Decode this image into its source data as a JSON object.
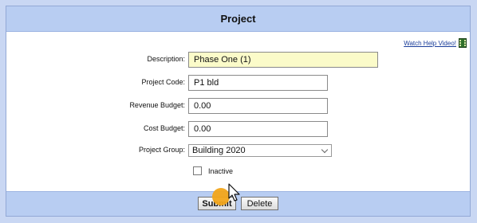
{
  "header": {
    "title": "Project"
  },
  "help": {
    "link_label": "Watch Help Video!",
    "icon": "film-icon"
  },
  "form": {
    "description": {
      "label": "Description:",
      "value": "Phase One (1)"
    },
    "project_code": {
      "label": "Project Code:",
      "value": "P1 bld"
    },
    "revenue_budget": {
      "label": "Revenue Budget:",
      "value": "0.00"
    },
    "cost_budget": {
      "label": "Cost Budget:",
      "value": "0.00"
    },
    "project_group": {
      "label": "Project Group:",
      "selected": "Building 2020"
    },
    "inactive": {
      "label": "Inactive",
      "checked": false
    }
  },
  "footer": {
    "submit_label": "Submit",
    "delete_label": "Delete"
  },
  "colors": {
    "header_bg": "#b8cdf2",
    "highlight_input": "#fbfbc9",
    "cursor_dot": "#f2a51a"
  }
}
